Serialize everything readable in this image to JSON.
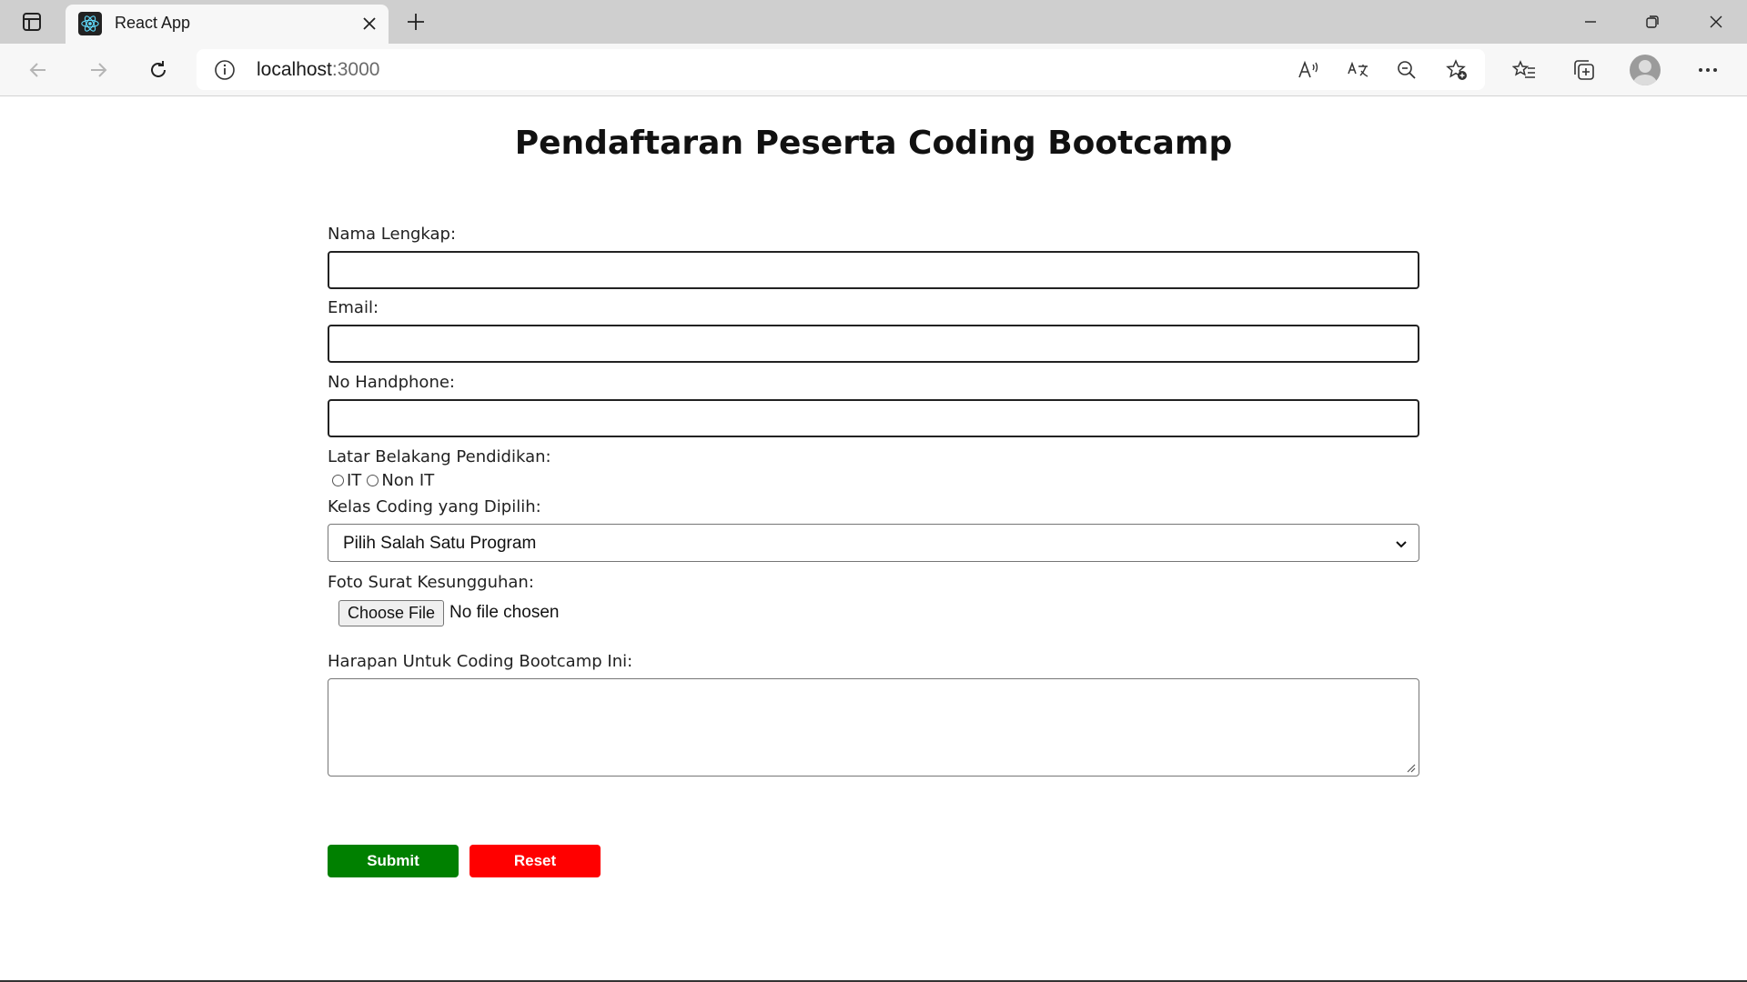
{
  "browser": {
    "tab_title": "React App",
    "url_host": "localhost",
    "url_port": ":3000"
  },
  "page": {
    "title": "Pendaftaran Peserta Coding Bootcamp"
  },
  "form": {
    "nama_label": "Nama Lengkap:",
    "email_label": "Email:",
    "phone_label": "No Handphone:",
    "education_label": "Latar Belakang Pendidikan:",
    "education_options": [
      "IT",
      "Non IT"
    ],
    "class_label": "Kelas Coding yang Dipilih:",
    "class_selected": "Pilih Salah Satu Program",
    "photo_label": "Foto Surat Kesungguhan:",
    "file_button": "Choose File",
    "file_status": "No file chosen",
    "hope_label": "Harapan Untuk Coding Bootcamp Ini:"
  },
  "actions": {
    "submit": "Submit",
    "reset": "Reset"
  },
  "colors": {
    "submit_bg": "#008000",
    "reset_bg": "#ff0000"
  }
}
